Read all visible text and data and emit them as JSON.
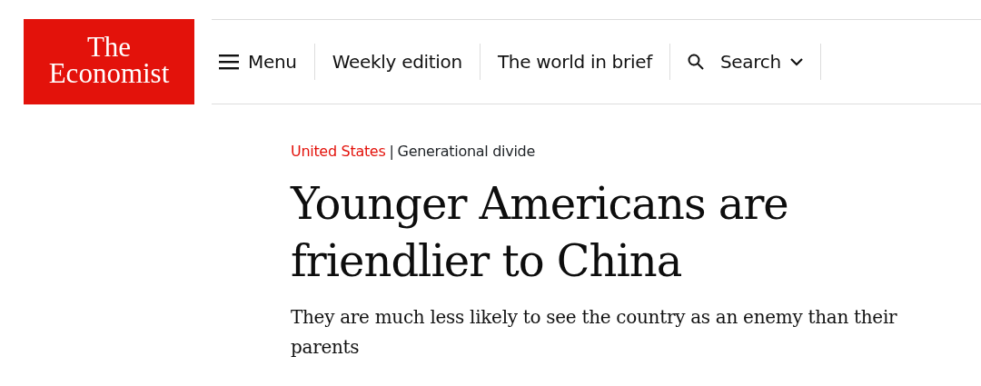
{
  "logo": {
    "line_1": "The",
    "line_2": "Economist"
  },
  "nav": [
    {
      "kind": "menu",
      "label": "Menu"
    },
    {
      "kind": "link",
      "label": "Weekly edition"
    },
    {
      "kind": "link",
      "label": "The world in brief"
    },
    {
      "kind": "search",
      "label": "Search"
    }
  ],
  "article": {
    "section": "United States",
    "separator": "|",
    "topic": "Generational divide",
    "headline": "Younger Americans are friendlier to China",
    "subtitle": "They are much less likely to see the country as an enemy than their parents"
  }
}
